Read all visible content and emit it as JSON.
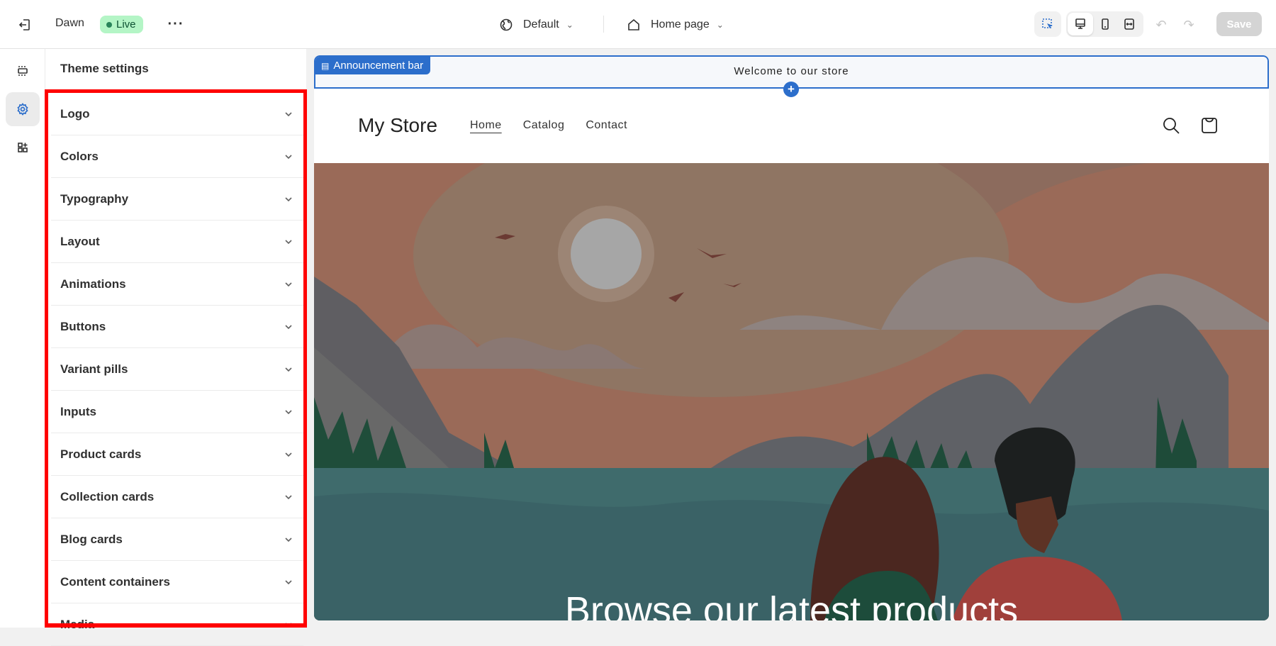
{
  "topbar": {
    "theme_name": "Dawn",
    "status_badge": "Live",
    "theme_select": "Default",
    "page_select": "Home page",
    "save_label": "Save"
  },
  "panel": {
    "title": "Theme settings",
    "items": [
      "Logo",
      "Colors",
      "Typography",
      "Layout",
      "Animations",
      "Buttons",
      "Variant pills",
      "Inputs",
      "Product cards",
      "Collection cards",
      "Blog cards",
      "Content containers",
      "Media"
    ]
  },
  "preview": {
    "section_tag": "Announcement bar",
    "announcement": "Welcome to our store",
    "store_name": "My Store",
    "nav": [
      "Home",
      "Catalog",
      "Contact"
    ],
    "hero_heading": "Browse our latest products"
  },
  "colors": {
    "accent": "#2c6ecb",
    "badge_bg": "#b4f5c6",
    "badge_dot": "#29845a",
    "highlight": "#ff0000"
  }
}
